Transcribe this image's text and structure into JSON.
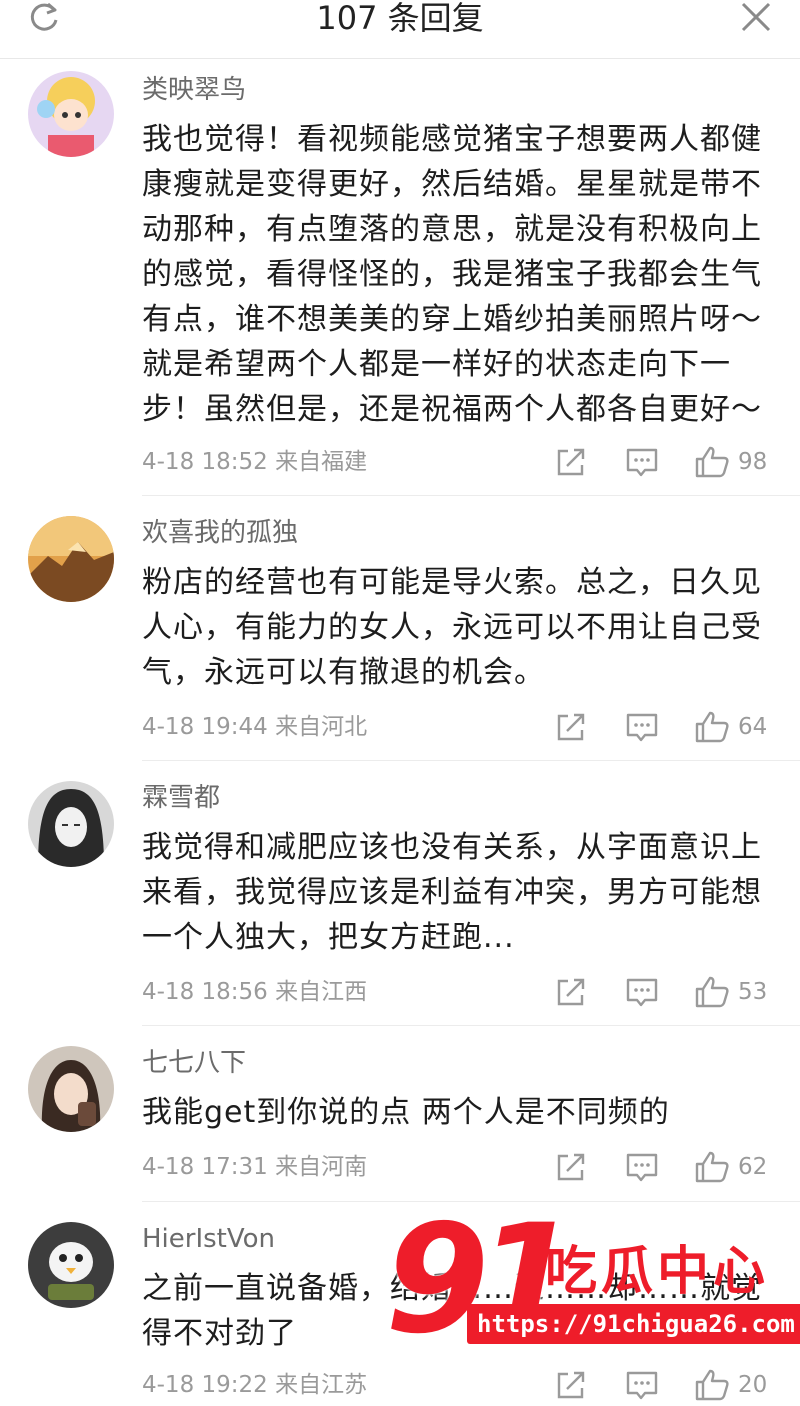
{
  "header": {
    "title": "107 条回复"
  },
  "comments": [
    {
      "author": "类映翠鸟",
      "text": "我也觉得！看视频能感觉猪宝子想要两人都健康瘦就是变得更好，然后结婚。星星就是带不动那种，有点堕落的意思，就是没有积极向上的感觉，看得怪怪的，我是猪宝子我都会生气有点，谁不想美美的穿上婚纱拍美丽照片呀～就是希望两个人都是一样好的状态走向下一步！虽然但是，还是祝福两个人都各自更好～",
      "meta": "4-18 18:52  来自福建",
      "likes": "98"
    },
    {
      "author": "欢喜我的孤独",
      "text": "粉店的经营也有可能是导火索。总之，日久见人心，有能力的女人，永远可以不用让自己受气，永远可以有撤退的机会。",
      "meta": "4-18 19:44  来自河北",
      "likes": "64"
    },
    {
      "author": "霖雪都",
      "text": "我觉得和减肥应该也没有关系，从字面意识上来看，我觉得应该是利益有冲突，男方可能想一个人独大，把女方赶跑...",
      "meta": "4-18 18:56  来自江西",
      "likes": "53"
    },
    {
      "author": "七七八下",
      "text": "我能get到你说的点 两个人是不同频的",
      "meta": "4-18 17:31  来自河南",
      "likes": "62"
    },
    {
      "author": "HierIstVon",
      "text": "之前一直说备婚，结婚……近……却……就觉得不对劲了",
      "meta": "4-18 19:22  来自江苏",
      "likes": "20"
    }
  ],
  "watermark": {
    "number": "91",
    "name": "吃瓜中心",
    "url": "https://91chigua26.com"
  },
  "colors": {
    "watermark_red": "#ee1d2a",
    "meta_gray": "#9a9a9a"
  },
  "icons": [
    "refresh-icon",
    "close-icon",
    "share-icon",
    "reply-icon",
    "like-icon"
  ]
}
